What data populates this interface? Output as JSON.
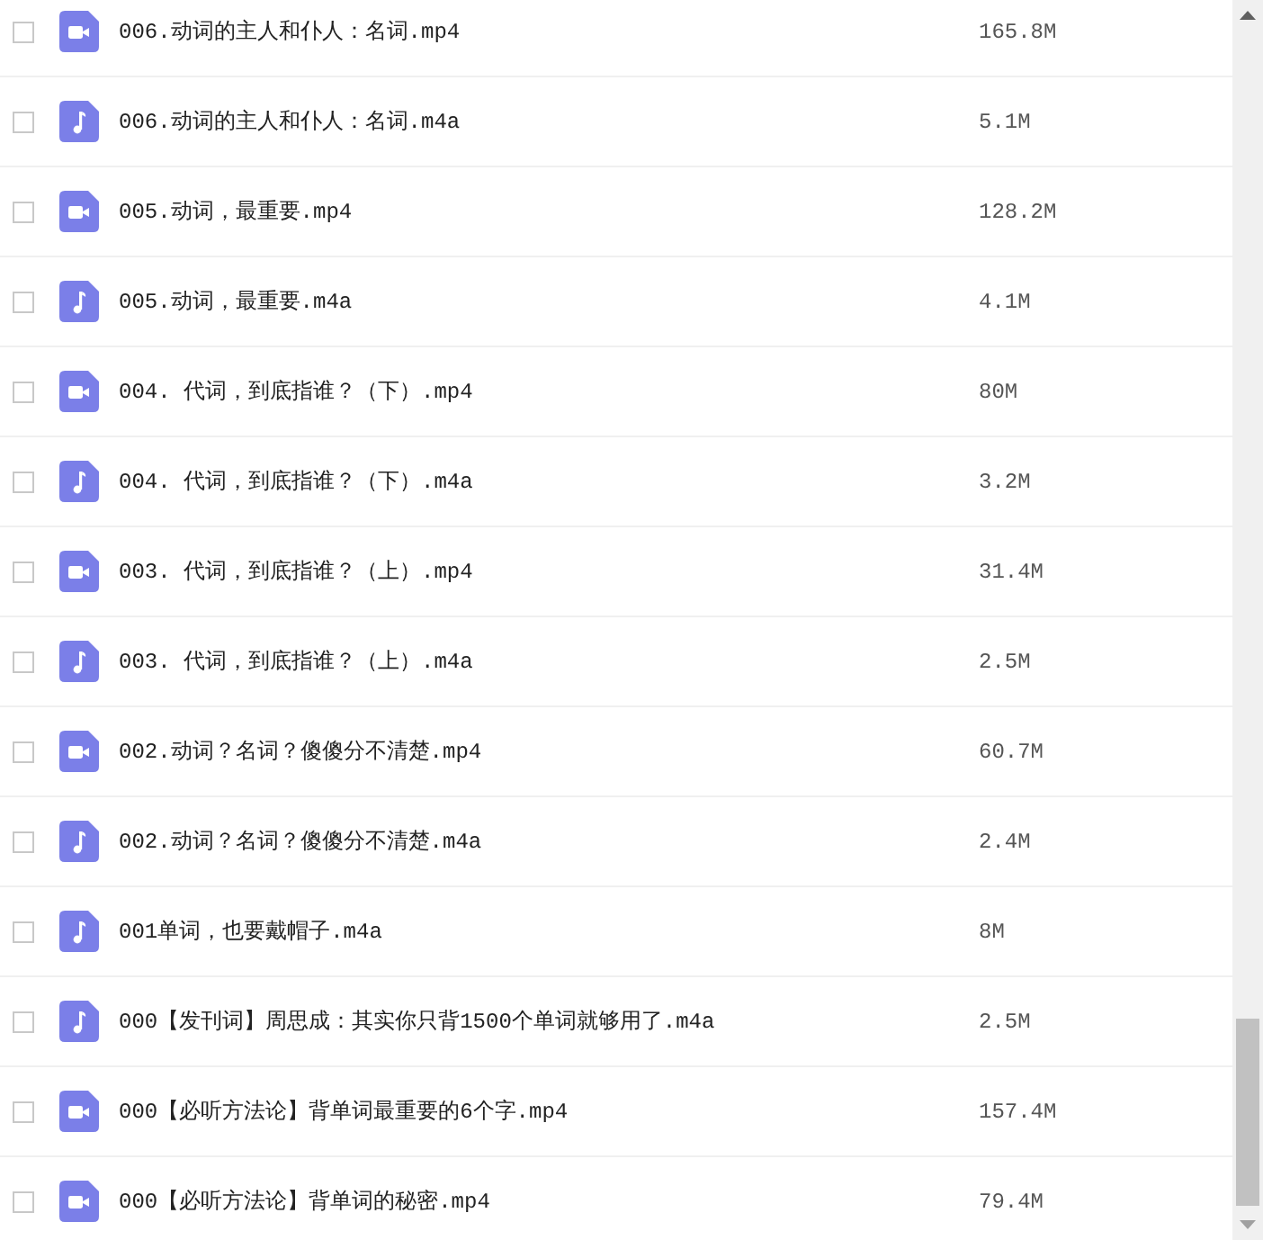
{
  "files": [
    {
      "name": "006.动词的主人和仆人：名词.mp4",
      "size": "165.8M",
      "kind": "video",
      "checked": false
    },
    {
      "name": "006.动词的主人和仆人：名词.m4a",
      "size": "5.1M",
      "kind": "audio",
      "checked": false
    },
    {
      "name": "005.动词，最重要.mp4",
      "size": "128.2M",
      "kind": "video",
      "checked": false
    },
    {
      "name": "005.动词，最重要.m4a",
      "size": "4.1M",
      "kind": "audio",
      "checked": false
    },
    {
      "name": "004. 代词，到底指谁？（下）.mp4",
      "size": "80M",
      "kind": "video",
      "checked": false
    },
    {
      "name": "004. 代词，到底指谁？（下）.m4a",
      "size": "3.2M",
      "kind": "audio",
      "checked": false
    },
    {
      "name": "003. 代词，到底指谁？（上）.mp4",
      "size": "31.4M",
      "kind": "video",
      "checked": false
    },
    {
      "name": "003. 代词，到底指谁？（上）.m4a",
      "size": "2.5M",
      "kind": "audio",
      "checked": false
    },
    {
      "name": "002.动词？名词？傻傻分不清楚.mp4",
      "size": "60.7M",
      "kind": "video",
      "checked": false
    },
    {
      "name": "002.动词？名词？傻傻分不清楚.m4a",
      "size": "2.4M",
      "kind": "audio",
      "checked": false
    },
    {
      "name": "001单词，也要戴帽子.m4a",
      "size": "8M",
      "kind": "audio",
      "checked": false
    },
    {
      "name": "000【发刊词】周思成：其实你只背1500个单词就够用了.m4a",
      "size": "2.5M",
      "kind": "audio",
      "checked": false
    },
    {
      "name": "000【必听方法论】背单词最重要的6个字.mp4",
      "size": "157.4M",
      "kind": "video",
      "checked": false
    },
    {
      "name": "000【必听方法论】背单词的秘密.mp4",
      "size": "79.4M",
      "kind": "video",
      "checked": false
    }
  ]
}
